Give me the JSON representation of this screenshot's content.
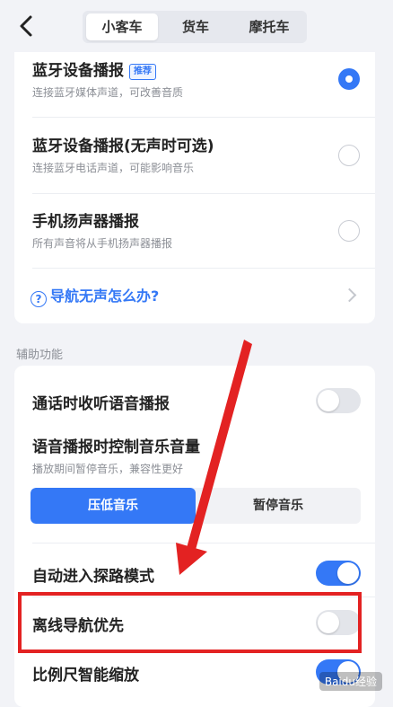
{
  "header": {
    "tabs": [
      {
        "label": "小客车",
        "active": true
      },
      {
        "label": "货车",
        "active": false
      },
      {
        "label": "摩托车",
        "active": false
      }
    ]
  },
  "output_options": [
    {
      "title": "蓝牙设备播报",
      "badge": "推荐",
      "subtitle": "连接蓝牙媒体声道，可改善音质",
      "selected": true
    },
    {
      "title": "蓝牙设备播报(无声时可选)",
      "subtitle": "连接蓝牙电话声道，可能影响音乐",
      "selected": false
    },
    {
      "title": "手机扬声器播报",
      "subtitle": "所有声音将从手机扬声器播报",
      "selected": false
    }
  ],
  "help_link": {
    "label": "导航无声怎么办?"
  },
  "aux_section": {
    "label": "辅助功能",
    "call_broadcast": {
      "label": "通话时收听语音播报",
      "on": false
    },
    "music_control": {
      "title": "语音播报时控制音乐音量",
      "subtitle": "播放期间暂停音乐，兼容性更好",
      "options": [
        "压低音乐",
        "暂停音乐"
      ],
      "selected": "压低音乐"
    },
    "auto_explore": {
      "label": "自动进入探路模式",
      "on": true
    },
    "offline_first": {
      "label": "离线导航优先",
      "on": false
    },
    "scale_zoom": {
      "label": "比例尺智能缩放",
      "on": true
    }
  },
  "colors": {
    "accent": "#3478f6",
    "highlight": "#e32222"
  },
  "watermark": "Baidu经验"
}
